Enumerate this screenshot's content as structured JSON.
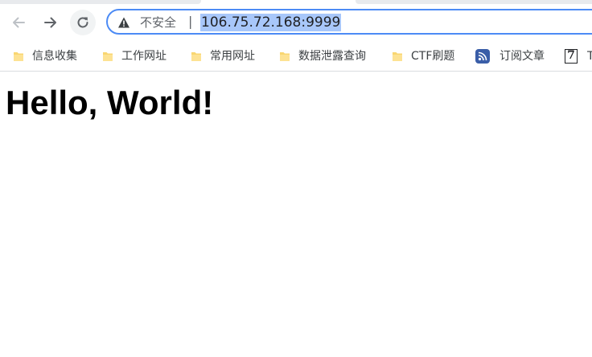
{
  "toolbar": {
    "back_icon": "arrow-left-icon",
    "forward_icon": "arrow-right-icon",
    "reload_icon": "reload-icon"
  },
  "omnibox": {
    "security_icon": "warning-triangle-icon",
    "security_label": "不安全",
    "separator": "|",
    "url": "106.75.72.168:9999",
    "border_color": "#4c8bf5",
    "selection_color": "#a8c7fa"
  },
  "bookmarks": {
    "items": [
      {
        "label": "信息收集",
        "icon": "folder-icon"
      },
      {
        "label": "工作网址",
        "icon": "folder-icon"
      },
      {
        "label": "常用网址",
        "icon": "folder-icon"
      },
      {
        "label": "数据泄露查询",
        "icon": "folder-icon"
      },
      {
        "label": "CTF刷题",
        "icon": "folder-icon"
      },
      {
        "label": "订阅文章",
        "icon": "rss-icon"
      },
      {
        "label": "T",
        "icon": "seven-icon",
        "icon_text": "7"
      }
    ]
  },
  "page": {
    "heading": "Hello, World!"
  }
}
